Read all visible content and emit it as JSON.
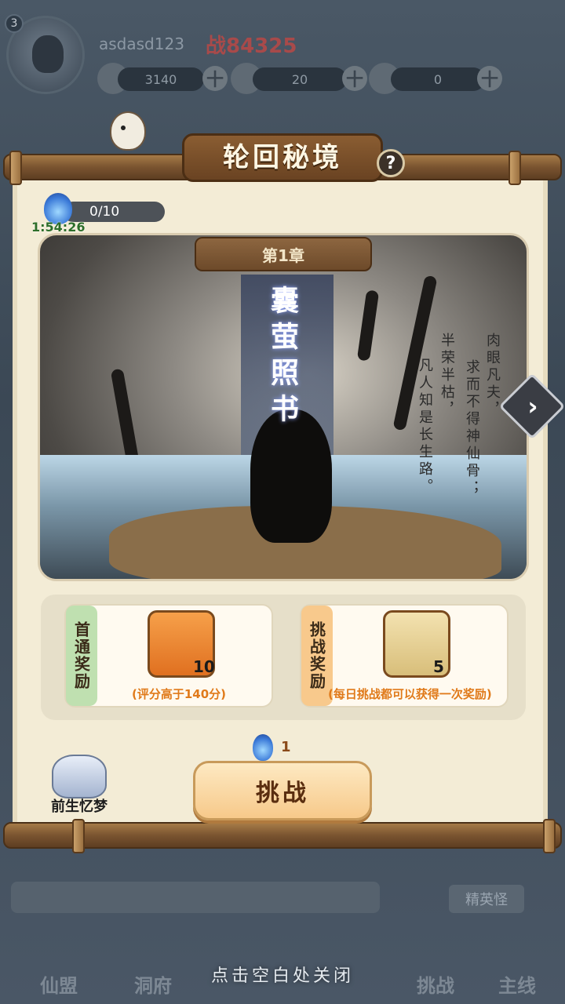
{
  "hud": {
    "level": "3",
    "username": "asdasd123",
    "power": "战84325",
    "currencies": [
      {
        "icon": "coin-icon",
        "value": "3140"
      },
      {
        "icon": "gold-ingot-icon",
        "value": "20"
      },
      {
        "icon": "gourd-icon",
        "value": "0"
      }
    ],
    "plus": "十",
    "elite_label": "精英怪",
    "nav": [
      "仙盟",
      "洞府",
      "挑战",
      "主线"
    ]
  },
  "panel": {
    "title": "轮回秘境",
    "help": "?",
    "energy": {
      "value": "0/10",
      "fraction": 0
    },
    "timer": "1:54:26",
    "chapter": {
      "tab": "第1章",
      "name": "囊萤照书",
      "poem": [
        "肉眼凡夫，",
        "求而不得神仙骨；",
        "半荣半枯，",
        "凡人知是长生路。"
      ]
    },
    "rewards": {
      "first_clear": {
        "label": "首通奖励",
        "item_icon": "gold-ingot-icon",
        "count": "10",
        "note": "(评分高于140分)"
      },
      "challenge": {
        "label": "挑战奖励",
        "item_icon": "bun-icon",
        "count": "5",
        "note": "(每日挑战都可以获得一次奖励)"
      }
    },
    "cost": "1",
    "challenge_button": "挑战",
    "memory_label": "前生忆梦"
  },
  "close_hint": "点击空白处关闭",
  "colors": {
    "paper": "#f3ecd6",
    "wood": "#7a5430",
    "first_clear_tab": "#bfe0b0",
    "challenge_tab": "#f8c98c",
    "accent_orange": "#e07a1a"
  }
}
